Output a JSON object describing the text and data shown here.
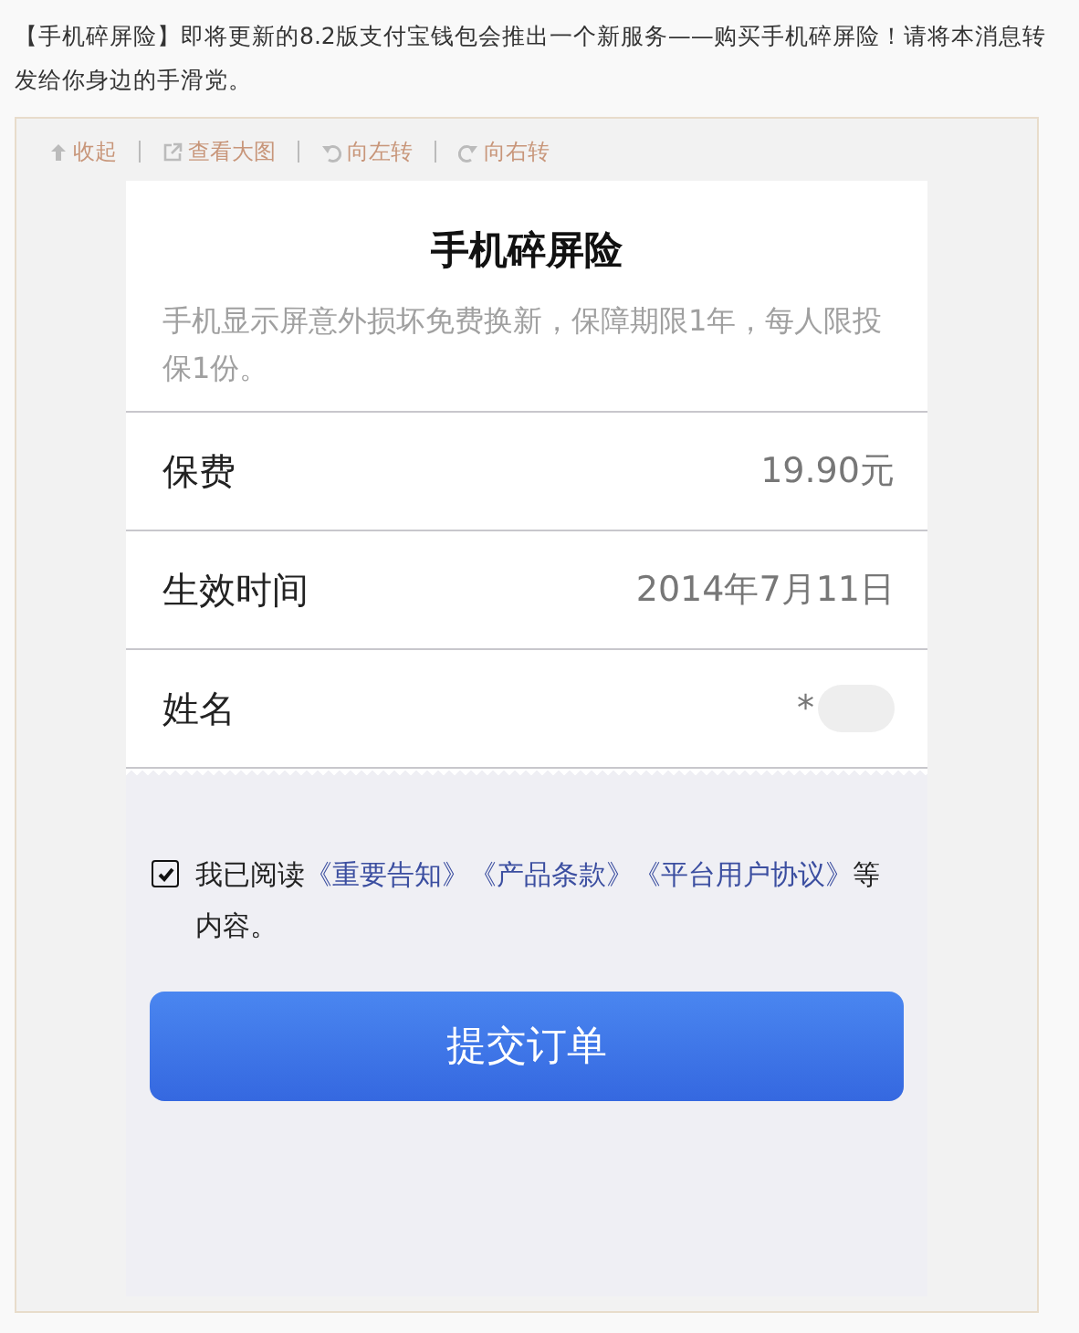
{
  "post": {
    "text": "【手机碎屏险】即将更新的8.2版支付宝钱包会推出一个新服务——购买手机碎屏险！请将本消息转发给你身边的手滑党。"
  },
  "toolbar": [
    {
      "kind": "collapse",
      "label": "收起"
    },
    {
      "kind": "open",
      "label": "查看大图"
    },
    {
      "kind": "rotate-left",
      "label": "向左转"
    },
    {
      "kind": "rotate-right",
      "label": "向右转"
    }
  ],
  "screen": {
    "title": "手机碎屏险",
    "subtitle": "手机显示屏意外损坏免费换新，保障期限1年，每人限投保1份。",
    "rows": [
      {
        "label": "保费",
        "value": "19.90元",
        "redacted": false
      },
      {
        "label": "生效时间",
        "value": "2014年7月11日",
        "redacted": false
      },
      {
        "label": "姓名",
        "value": "*",
        "redacted": true
      }
    ],
    "agreement": {
      "checked": true,
      "prefix": "我已阅读",
      "links": [
        "《重要告知》",
        "《产品条款》",
        "《平台用户协议》"
      ],
      "suffix": "等内容。"
    },
    "submit": "提交订单"
  }
}
